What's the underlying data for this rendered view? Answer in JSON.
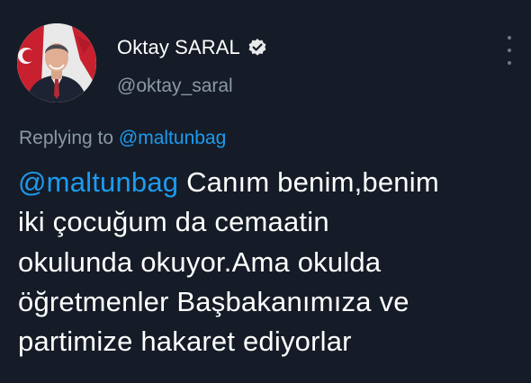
{
  "author": {
    "display_name": "Oktay SARAL",
    "handle": "@oktay_saral",
    "verified": true
  },
  "icons": {
    "verified": "verified-badge-icon",
    "more": "more-vertical-icon"
  },
  "reply": {
    "prefix": "Replying to",
    "mention": "@maltunbag"
  },
  "tweet": {
    "mention": "@maltunbag",
    "lines": [
      " Canım benim,benim",
      "iki çocuğum da cemaatin",
      "okulunda okuyor.Ama okulda",
      "öğretmenler Başbakanımıza ve",
      "partimize hakaret ediyorlar"
    ]
  },
  "colors": {
    "background": "#151c27",
    "text": "#ffffff",
    "secondary": "#8b98a5",
    "accent": "#1d9bf0"
  }
}
